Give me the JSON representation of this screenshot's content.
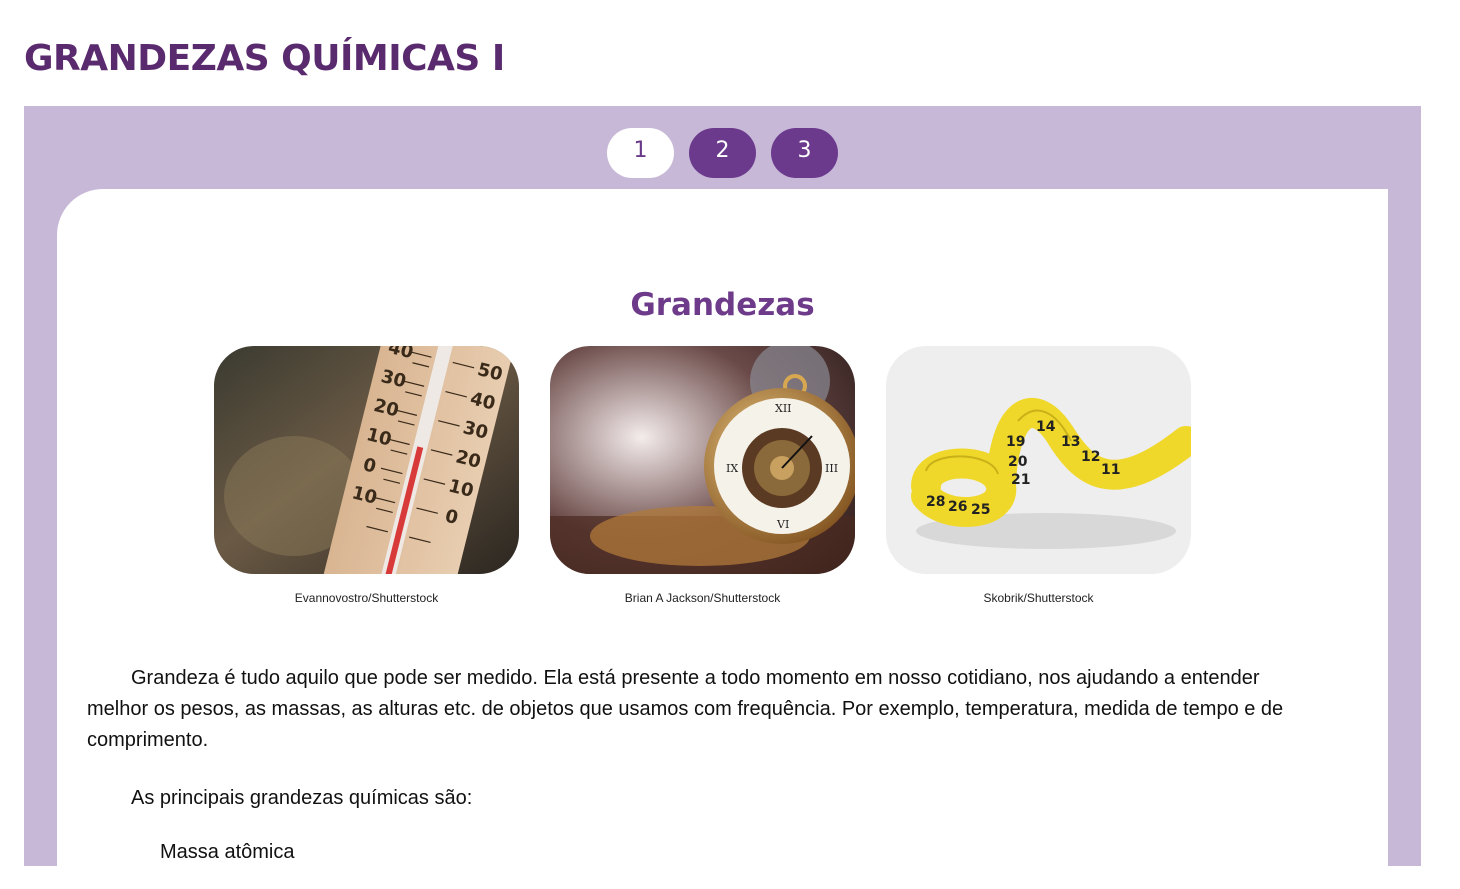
{
  "title": "GRANDEZAS QUÍMICAS I",
  "pager": {
    "pages": [
      "1",
      "2",
      "3"
    ],
    "active": "1"
  },
  "content": {
    "heading": "Grandezas",
    "images": [
      {
        "subject": "thermometer",
        "credit": "Evannovostro/Shutterstock"
      },
      {
        "subject": "pocket-watch",
        "credit": "Brian A Jackson/Shutterstock"
      },
      {
        "subject": "measuring-tape",
        "credit": "Skobrik/Shutterstock"
      }
    ],
    "paragraph1": "Grandeza é tudo aquilo que pode ser medido. Ela está presente a todo momento em nosso cotidiano, nos ajudando a entender melhor os pesos, as massas, as alturas etc. de objetos que usamos com frequência. Por exemplo, temperatura, medida de tempo e de comprimento.",
    "paragraph2": "As principais grandezas químicas são:",
    "list_first_item": "Massa atômica"
  },
  "colors": {
    "title": "#5a2a6e",
    "panel": "#c8b8d8",
    "accent": "#6b3a8d",
    "heading": "#6e3b8a"
  }
}
